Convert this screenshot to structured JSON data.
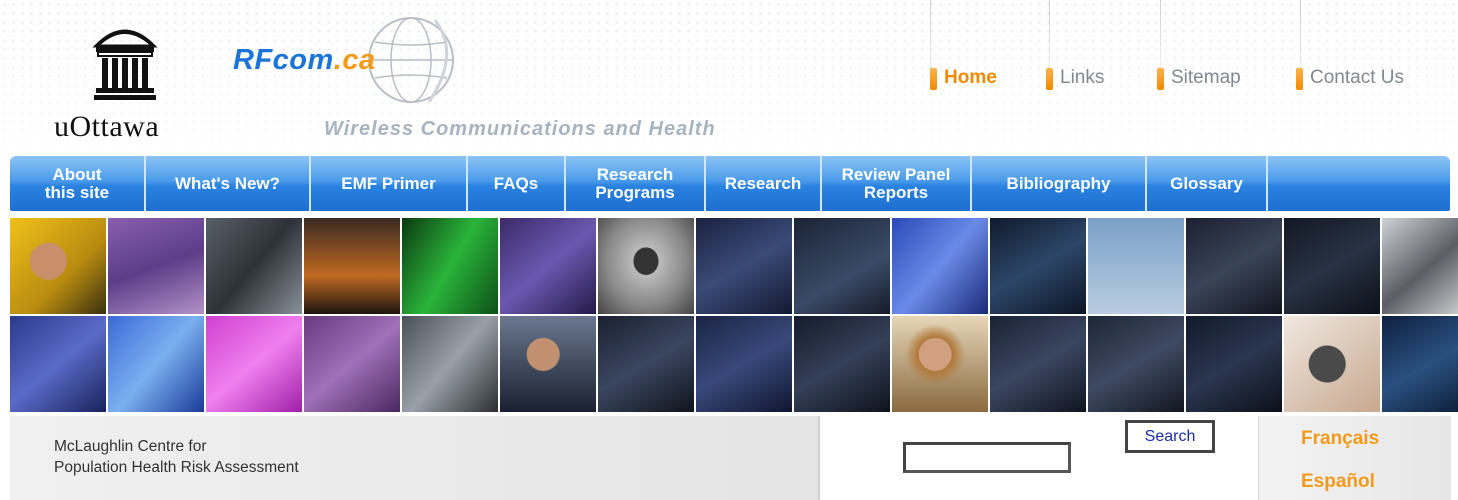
{
  "header": {
    "university": "uOttawa",
    "site_logo": {
      "main": "RFcom",
      "suffix": ".ca"
    },
    "tagline": "Wireless Communications and Health",
    "top_links": [
      {
        "label": "Home",
        "active": true
      },
      {
        "label": "Links",
        "active": false
      },
      {
        "label": "Sitemap",
        "active": false
      },
      {
        "label": "Contact Us",
        "active": false
      }
    ]
  },
  "nav": {
    "items": [
      {
        "label": "About\nthis site"
      },
      {
        "label": "What's New?"
      },
      {
        "label": "EMF Primer"
      },
      {
        "label": "FAQs"
      },
      {
        "label": "Research\nPrograms"
      },
      {
        "label": "Research"
      },
      {
        "label": "Review Panel\nReports"
      },
      {
        "label": "Bibliography"
      },
      {
        "label": "Glossary"
      },
      {
        "label": ""
      }
    ]
  },
  "footer": {
    "centre_line1": "McLaughlin Centre for",
    "centre_line2": "Population Health Risk Assessment",
    "search_button": "Search",
    "languages": [
      "Français",
      "Español"
    ]
  },
  "colors": {
    "accent_orange": "#f39a1a",
    "nav_blue": "#2a82e0",
    "brand_blue": "#1a74d9"
  }
}
